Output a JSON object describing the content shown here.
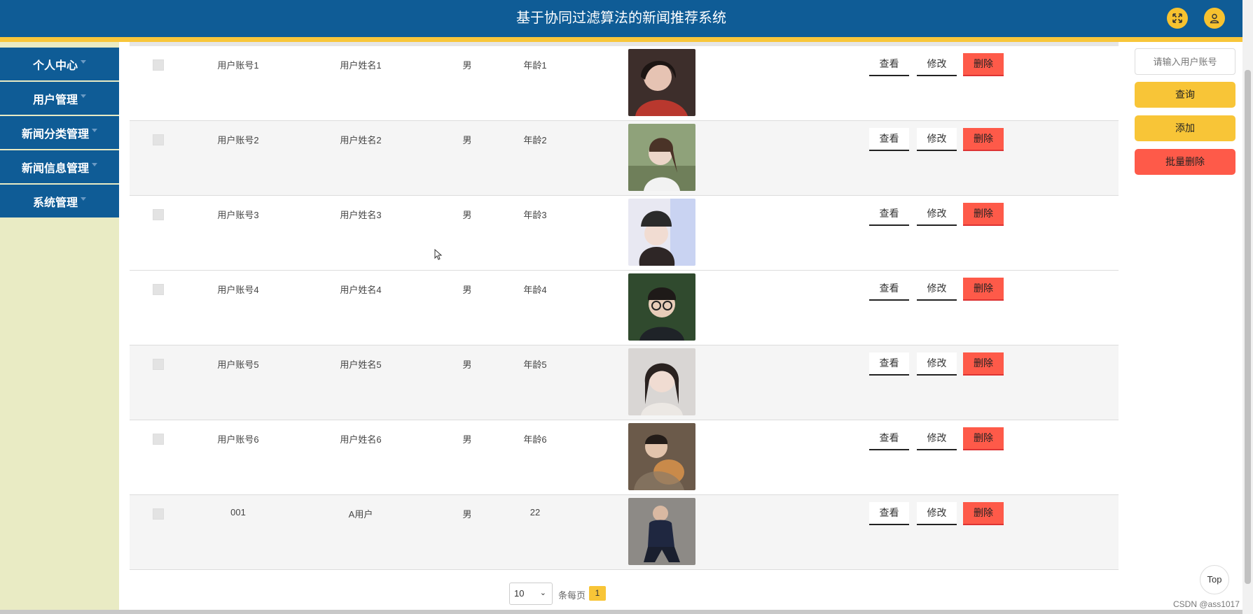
{
  "header": {
    "title": "基于协同过滤算法的新闻推荐系统",
    "fullscreen_icon": "expand-icon",
    "user_icon": "user-icon",
    "accent": "#f8c537",
    "brand": "#0f5c96"
  },
  "sidebar": {
    "items": [
      {
        "label": "个人中心"
      },
      {
        "label": "用户管理"
      },
      {
        "label": "新闻分类管理"
      },
      {
        "label": "新闻信息管理"
      },
      {
        "label": "系统管理"
      }
    ]
  },
  "table": {
    "rows": [
      {
        "account": "用户账号1",
        "name": "用户姓名1",
        "gender": "男",
        "age": "年龄1"
      },
      {
        "account": "用户账号2",
        "name": "用户姓名2",
        "gender": "男",
        "age": "年龄2"
      },
      {
        "account": "用户账号3",
        "name": "用户姓名3",
        "gender": "男",
        "age": "年龄3"
      },
      {
        "account": "用户账号4",
        "name": "用户姓名4",
        "gender": "男",
        "age": "年龄4"
      },
      {
        "account": "用户账号5",
        "name": "用户姓名5",
        "gender": "男",
        "age": "年龄5"
      },
      {
        "account": "用户账号6",
        "name": "用户姓名6",
        "gender": "男",
        "age": "年龄6"
      },
      {
        "account": "001",
        "name": "A用户",
        "gender": "男",
        "age": "22"
      }
    ],
    "actions": {
      "view": "查看",
      "edit": "修改",
      "delete": "删除"
    }
  },
  "panel": {
    "search_placeholder": "请输入用户账号",
    "query": "查询",
    "add": "添加",
    "batch_delete": "批量删除"
  },
  "pagination": {
    "page_size": "10",
    "per_page_label": "条每页",
    "current_page": "1"
  },
  "top_button": "Top",
  "watermark": "CSDN @ass1017"
}
